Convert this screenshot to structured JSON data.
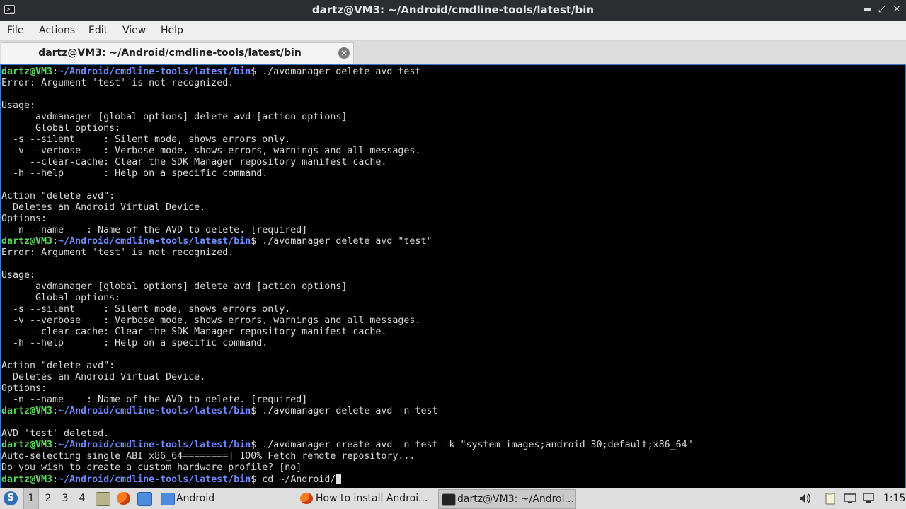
{
  "window": {
    "title": "dartz@VM3: ~/Android/cmdline-tools/latest/bin",
    "minimize_glyph": "▬",
    "maximize_glyph": "⤢",
    "close_glyph": "✕"
  },
  "menu": {
    "file": "File",
    "actions": "Actions",
    "edit": "Edit",
    "view": "View",
    "help": "Help"
  },
  "tab": {
    "label": "dartz@VM3: ~/Android/cmdline-tools/latest/bin",
    "close_glyph": "×"
  },
  "terminal": {
    "prompt_user": "dartz@VM3",
    "prompt_sep": ":",
    "prompt_path": "~/Android/cmdline-tools/latest/bin",
    "prompt_end": "$",
    "colors": {
      "user": "#5cd85c",
      "path": "#6f8cff",
      "text": "#d8d8d8",
      "background": "#000000"
    },
    "lines": [
      {
        "prompt": true,
        "text": " ./avdmanager delete avd test"
      },
      {
        "text": "Error: Argument 'test' is not recognized."
      },
      {
        "text": ""
      },
      {
        "text": "Usage:"
      },
      {
        "text": "      avdmanager [global options] delete avd [action options]"
      },
      {
        "text": "      Global options:"
      },
      {
        "text": "  -s --silent     : Silent mode, shows errors only."
      },
      {
        "text": "  -v --verbose    : Verbose mode, shows errors, warnings and all messages."
      },
      {
        "text": "     --clear-cache: Clear the SDK Manager repository manifest cache."
      },
      {
        "text": "  -h --help       : Help on a specific command."
      },
      {
        "text": ""
      },
      {
        "text": "Action \"delete avd\":"
      },
      {
        "text": "  Deletes an Android Virtual Device."
      },
      {
        "text": "Options:"
      },
      {
        "text": "  -n --name    : Name of the AVD to delete. [required]"
      },
      {
        "prompt": true,
        "text": " ./avdmanager delete avd \"test\""
      },
      {
        "text": "Error: Argument 'test' is not recognized."
      },
      {
        "text": ""
      },
      {
        "text": "Usage:"
      },
      {
        "text": "      avdmanager [global options] delete avd [action options]"
      },
      {
        "text": "      Global options:"
      },
      {
        "text": "  -s --silent     : Silent mode, shows errors only."
      },
      {
        "text": "  -v --verbose    : Verbose mode, shows errors, warnings and all messages."
      },
      {
        "text": "     --clear-cache: Clear the SDK Manager repository manifest cache."
      },
      {
        "text": "  -h --help       : Help on a specific command."
      },
      {
        "text": ""
      },
      {
        "text": "Action \"delete avd\":"
      },
      {
        "text": "  Deletes an Android Virtual Device."
      },
      {
        "text": "Options:"
      },
      {
        "text": "  -n --name    : Name of the AVD to delete. [required]"
      },
      {
        "prompt": true,
        "text": " ./avdmanager delete avd -n test"
      },
      {
        "text": ""
      },
      {
        "text": "AVD 'test' deleted."
      },
      {
        "prompt": true,
        "text": " ./avdmanager create avd -n test -k \"system-images;android-30;default;x86_64\""
      },
      {
        "text": "Auto-selecting single ABI x86_64========] 100% Fetch remote repository..."
      },
      {
        "text": "Do you wish to create a custom hardware profile? [no]"
      },
      {
        "prompt": true,
        "text": " cd ~/Android/",
        "cursor": true
      }
    ]
  },
  "taskbar": {
    "start_glyph": "S",
    "workspaces": [
      "1",
      "2",
      "3",
      "4"
    ],
    "active_workspace": "1",
    "folder_task_label": "Android",
    "browser_task_label": "How to install Androi...",
    "terminal_task_label": "dartz@VM3: ~/Androi...",
    "clock": "1:15"
  }
}
